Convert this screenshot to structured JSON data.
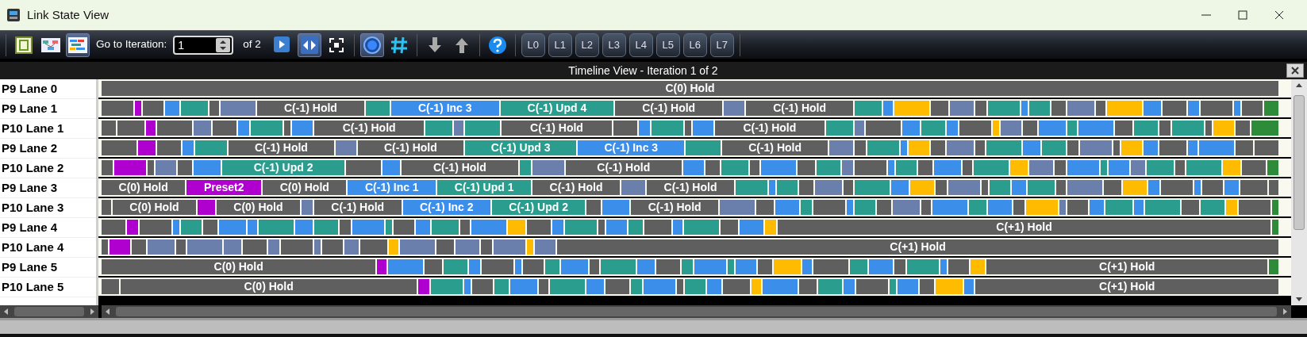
{
  "window": {
    "title": "Link State View"
  },
  "toolbar": {
    "views": [
      {
        "kind": "layout",
        "selected": false
      },
      {
        "kind": "diagram",
        "selected": false
      },
      {
        "kind": "timeline",
        "selected": true
      }
    ],
    "iteration_label": "Go to Iteration:",
    "iteration_value": "1",
    "iteration_total": "of 2",
    "tools": [
      {
        "kind": "play",
        "selected": false
      },
      {
        "kind": "sync",
        "selected": true
      },
      {
        "kind": "fit",
        "selected": false
      },
      {
        "kind": "circle",
        "selected": true
      },
      {
        "kind": "hash",
        "selected": false
      },
      {
        "kind": "down",
        "selected": false
      },
      {
        "kind": "up",
        "selected": false
      },
      {
        "kind": "help",
        "selected": false
      }
    ],
    "lane_buttons": [
      "L0",
      "L1",
      "L2",
      "L3",
      "L4",
      "L5",
      "L6",
      "L7"
    ]
  },
  "panel": {
    "title": "Timeline View - Iteration 1 of 2"
  },
  "lanes": [
    {
      "name": "P9 Lane 0",
      "segments": [
        {
          "color": "#5f5f5f",
          "label": "C(0) Hold"
        }
      ]
    },
    {
      "name": "P9 Lane 1",
      "segments": [
        {
          "color": "#5f5f5f"
        },
        {
          "color": "#b000d0"
        },
        {
          "color": "#5f5f5f"
        },
        {
          "color": "#3b8eea"
        },
        {
          "color": "#2a9d8f"
        },
        {
          "color": "#5f5f5f"
        },
        {
          "color": "#6b7fad"
        },
        {
          "color": "#5f5f5f",
          "label": "C(-1) Hold"
        },
        {
          "color": "#2a9d8f"
        },
        {
          "color": "#3b8eea",
          "label": "C(-1) Inc 3"
        },
        {
          "color": "#2a9d8f",
          "label": "C(-1) Upd 4"
        },
        {
          "color": "#5f5f5f",
          "label": "C(-1) Hold"
        },
        {
          "color": "#6b7fad"
        },
        {
          "color": "#5f5f5f",
          "label": "C(-1) Hold"
        },
        {
          "color": "#2a9d8f"
        },
        {
          "color": "#3b8eea"
        },
        {
          "color": "#ffbb00"
        },
        {
          "color": "#5f5f5f"
        },
        {
          "color": "#6b7fad"
        },
        {
          "color": "#5f5f5f"
        },
        {
          "color": "#2a9d8f"
        },
        {
          "color": "#3b8eea"
        },
        {
          "color": "#2a9d8f"
        },
        {
          "color": "#5f5f5f"
        },
        {
          "color": "#6b7fad"
        },
        {
          "color": "#5f5f5f"
        },
        {
          "color": "#ffbb00"
        },
        {
          "color": "#3b8eea"
        },
        {
          "color": "#5f5f5f"
        },
        {
          "color": "#3b8eea"
        },
        {
          "color": "#5f5f5f"
        },
        {
          "color": "#3b8eea"
        },
        {
          "color": "#5f5f5f"
        },
        {
          "color": "#2e8b3a"
        }
      ]
    },
    {
      "name": "P10 Lane 1",
      "segments": [
        {
          "color": "#5f5f5f"
        },
        {
          "color": "#5f5f5f"
        },
        {
          "color": "#b000d0"
        },
        {
          "color": "#5f5f5f"
        },
        {
          "color": "#6b7fad"
        },
        {
          "color": "#5f5f5f"
        },
        {
          "color": "#3b8eea"
        },
        {
          "color": "#2a9d8f"
        },
        {
          "color": "#5f5f5f"
        },
        {
          "color": "#3b8eea"
        },
        {
          "color": "#5f5f5f",
          "label": "C(-1) Hold"
        },
        {
          "color": "#2a9d8f"
        },
        {
          "color": "#6b7fad"
        },
        {
          "color": "#2a9d8f"
        },
        {
          "color": "#5f5f5f",
          "label": "C(-1) Hold"
        },
        {
          "color": "#5f5f5f"
        },
        {
          "color": "#3b8eea"
        },
        {
          "color": "#2a9d8f"
        },
        {
          "color": "#5f5f5f"
        },
        {
          "color": "#3b8eea"
        },
        {
          "color": "#5f5f5f",
          "label": "C(-1) Hold"
        },
        {
          "color": "#2a9d8f"
        },
        {
          "color": "#6b7fad"
        },
        {
          "color": "#5f5f5f"
        },
        {
          "color": "#3b8eea"
        },
        {
          "color": "#2a9d8f"
        },
        {
          "color": "#3b8eea"
        },
        {
          "color": "#5f5f5f"
        },
        {
          "color": "#ffbb00"
        },
        {
          "color": "#6b7fad"
        },
        {
          "color": "#5f5f5f"
        },
        {
          "color": "#3b8eea"
        },
        {
          "color": "#2a9d8f"
        },
        {
          "color": "#3b8eea"
        },
        {
          "color": "#5f5f5f"
        },
        {
          "color": "#2a9d8f"
        },
        {
          "color": "#5f5f5f"
        },
        {
          "color": "#2a9d8f"
        },
        {
          "color": "#5f5f5f"
        },
        {
          "color": "#ffbb00"
        },
        {
          "color": "#5f5f5f"
        },
        {
          "color": "#2e8b3a"
        }
      ]
    },
    {
      "name": "P9 Lane 2",
      "segments": [
        {
          "color": "#5f5f5f"
        },
        {
          "color": "#b000d0"
        },
        {
          "color": "#5f5f5f"
        },
        {
          "color": "#3b8eea"
        },
        {
          "color": "#2a9d8f"
        },
        {
          "color": "#5f5f5f",
          "label": "C(-1) Hold"
        },
        {
          "color": "#6b7fad"
        },
        {
          "color": "#5f5f5f",
          "label": "C(-1) Hold"
        },
        {
          "color": "#2a9d8f",
          "label": "C(-1) Upd 3"
        },
        {
          "color": "#3b8eea",
          "label": "C(-1) Inc 3"
        },
        {
          "color": "#2a9d8f"
        },
        {
          "color": "#5f5f5f",
          "label": "C(-1) Hold"
        },
        {
          "color": "#6b7fad"
        },
        {
          "color": "#5f5f5f"
        },
        {
          "color": "#2a9d8f"
        },
        {
          "color": "#3b8eea"
        },
        {
          "color": "#ffbb00"
        },
        {
          "color": "#5f5f5f"
        },
        {
          "color": "#6b7fad"
        },
        {
          "color": "#5f5f5f"
        },
        {
          "color": "#2a9d8f"
        },
        {
          "color": "#3b8eea"
        },
        {
          "color": "#2a9d8f"
        },
        {
          "color": "#5f5f5f"
        },
        {
          "color": "#6b7fad"
        },
        {
          "color": "#5f5f5f"
        },
        {
          "color": "#ffbb00"
        },
        {
          "color": "#3b8eea"
        },
        {
          "color": "#5f5f5f"
        },
        {
          "color": "#3b8eea"
        },
        {
          "color": "#3b8eea"
        },
        {
          "color": "#5f5f5f"
        },
        {
          "color": "#5f5f5f"
        }
      ]
    },
    {
      "name": "P10 Lane 2",
      "segments": [
        {
          "color": "#5f5f5f"
        },
        {
          "color": "#b000d0"
        },
        {
          "color": "#5f5f5f"
        },
        {
          "color": "#6b7fad"
        },
        {
          "color": "#5f5f5f"
        },
        {
          "color": "#3b8eea"
        },
        {
          "color": "#2a9d8f",
          "label": "C(-1) Upd 2"
        },
        {
          "color": "#5f5f5f"
        },
        {
          "color": "#3b8eea"
        },
        {
          "color": "#5f5f5f",
          "label": "C(-1) Hold"
        },
        {
          "color": "#2a9d8f"
        },
        {
          "color": "#6b7fad"
        },
        {
          "color": "#5f5f5f",
          "label": "C(-1) Hold"
        },
        {
          "color": "#3b8eea"
        },
        {
          "color": "#5f5f5f"
        },
        {
          "color": "#2a9d8f"
        },
        {
          "color": "#5f5f5f"
        },
        {
          "color": "#3b8eea"
        },
        {
          "color": "#5f5f5f"
        },
        {
          "color": "#2a9d8f"
        },
        {
          "color": "#6b7fad"
        },
        {
          "color": "#5f5f5f"
        },
        {
          "color": "#3b8eea"
        },
        {
          "color": "#2a9d8f"
        },
        {
          "color": "#5f5f5f"
        },
        {
          "color": "#3b8eea"
        },
        {
          "color": "#5f5f5f"
        },
        {
          "color": "#2a9d8f"
        },
        {
          "color": "#ffbb00"
        },
        {
          "color": "#6b7fad"
        },
        {
          "color": "#5f5f5f"
        },
        {
          "color": "#3b8eea"
        },
        {
          "color": "#2a9d8f"
        },
        {
          "color": "#3b8eea"
        },
        {
          "color": "#6b7fad"
        },
        {
          "color": "#2a9d8f"
        },
        {
          "color": "#5f5f5f"
        },
        {
          "color": "#2a9d8f"
        },
        {
          "color": "#ffbb00"
        },
        {
          "color": "#5f5f5f"
        },
        {
          "color": "#2e8b3a"
        }
      ]
    },
    {
      "name": "P9 Lane 3",
      "segments": [
        {
          "color": "#5f5f5f",
          "label": "C(0) Hold"
        },
        {
          "color": "#b000d0",
          "label": "Preset2"
        },
        {
          "color": "#5f5f5f",
          "label": "C(0) Hold"
        },
        {
          "color": "#3b8eea",
          "label": "C(-1) Inc 1"
        },
        {
          "color": "#2a9d8f",
          "label": "C(-1) Upd 1"
        },
        {
          "color": "#5f5f5f",
          "label": "C(-1) Hold"
        },
        {
          "color": "#6b7fad"
        },
        {
          "color": "#5f5f5f",
          "label": "C(-1) Hold"
        },
        {
          "color": "#2a9d8f"
        },
        {
          "color": "#3b8eea"
        },
        {
          "color": "#2a9d8f"
        },
        {
          "color": "#5f5f5f"
        },
        {
          "color": "#6b7fad"
        },
        {
          "color": "#5f5f5f"
        },
        {
          "color": "#2a9d8f"
        },
        {
          "color": "#3b8eea"
        },
        {
          "color": "#ffbb00"
        },
        {
          "color": "#5f5f5f"
        },
        {
          "color": "#6b7fad"
        },
        {
          "color": "#5f5f5f"
        },
        {
          "color": "#2a9d8f"
        },
        {
          "color": "#3b8eea"
        },
        {
          "color": "#2a9d8f"
        },
        {
          "color": "#5f5f5f"
        },
        {
          "color": "#6b7fad"
        },
        {
          "color": "#5f5f5f"
        },
        {
          "color": "#ffbb00"
        },
        {
          "color": "#3b8eea"
        },
        {
          "color": "#5f5f5f"
        },
        {
          "color": "#3b8eea"
        },
        {
          "color": "#5f5f5f"
        },
        {
          "color": "#3b8eea"
        },
        {
          "color": "#5f5f5f"
        },
        {
          "color": "#5f5f5f"
        }
      ]
    },
    {
      "name": "P10 Lane 3",
      "segments": [
        {
          "color": "#5f5f5f"
        },
        {
          "color": "#5f5f5f",
          "label": "C(0) Hold"
        },
        {
          "color": "#b000d0"
        },
        {
          "color": "#5f5f5f",
          "label": "C(0) Hold"
        },
        {
          "color": "#6b7fad"
        },
        {
          "color": "#5f5f5f",
          "label": "C(-1) Hold"
        },
        {
          "color": "#3b8eea",
          "label": "C(-1) Inc 2"
        },
        {
          "color": "#2a9d8f",
          "label": "C(-1) Upd 2"
        },
        {
          "color": "#5f5f5f"
        },
        {
          "color": "#3b8eea"
        },
        {
          "color": "#5f5f5f",
          "label": "C(-1) Hold"
        },
        {
          "color": "#6b7fad"
        },
        {
          "color": "#5f5f5f"
        },
        {
          "color": "#3b8eea"
        },
        {
          "color": "#2a9d8f"
        },
        {
          "color": "#5f5f5f"
        },
        {
          "color": "#3b8eea"
        },
        {
          "color": "#2a9d8f"
        },
        {
          "color": "#5f5f5f"
        },
        {
          "color": "#6b7fad"
        },
        {
          "color": "#5f5f5f"
        },
        {
          "color": "#3b8eea"
        },
        {
          "color": "#2a9d8f"
        },
        {
          "color": "#3b8eea"
        },
        {
          "color": "#5f5f5f"
        },
        {
          "color": "#ffbb00"
        },
        {
          "color": "#6b7fad"
        },
        {
          "color": "#5f5f5f"
        },
        {
          "color": "#3b8eea"
        },
        {
          "color": "#2a9d8f"
        },
        {
          "color": "#3b8eea"
        },
        {
          "color": "#2a9d8f"
        },
        {
          "color": "#5f5f5f"
        },
        {
          "color": "#2a9d8f"
        },
        {
          "color": "#ffbb00"
        },
        {
          "color": "#5f5f5f"
        },
        {
          "color": "#2e8b3a"
        }
      ]
    },
    {
      "name": "P9 Lane 4",
      "segments": [
        {
          "color": "#5f5f5f"
        },
        {
          "color": "#b000d0"
        },
        {
          "color": "#5f5f5f"
        },
        {
          "color": "#3b8eea"
        },
        {
          "color": "#2a9d8f"
        },
        {
          "color": "#5f5f5f"
        },
        {
          "color": "#3b8eea"
        },
        {
          "color": "#3b8eea"
        },
        {
          "color": "#2a9d8f"
        },
        {
          "color": "#3b8eea"
        },
        {
          "color": "#2a9d8f"
        },
        {
          "color": "#5f5f5f"
        },
        {
          "color": "#3b8eea"
        },
        {
          "color": "#2a9d8f"
        },
        {
          "color": "#5f5f5f"
        },
        {
          "color": "#3b8eea"
        },
        {
          "color": "#2a9d8f"
        },
        {
          "color": "#5f5f5f"
        },
        {
          "color": "#3b8eea"
        },
        {
          "color": "#ffbb00"
        },
        {
          "color": "#5f5f5f"
        },
        {
          "color": "#3b8eea"
        },
        {
          "color": "#2a9d8f"
        },
        {
          "color": "#5f5f5f"
        },
        {
          "color": "#3b8eea"
        },
        {
          "color": "#2a9d8f"
        },
        {
          "color": "#5f5f5f"
        },
        {
          "color": "#3b8eea"
        },
        {
          "color": "#2a9d8f"
        },
        {
          "color": "#5f5f5f"
        },
        {
          "color": "#3b8eea"
        },
        {
          "color": "#ffbb00"
        },
        {
          "color": "#5f5f5f",
          "label": "C(+1) Hold"
        },
        {
          "color": "#2e8b3a"
        }
      ]
    },
    {
      "name": "P10 Lane 4",
      "segments": [
        {
          "color": "#5f5f5f"
        },
        {
          "color": "#b000d0"
        },
        {
          "color": "#5f5f5f"
        },
        {
          "color": "#6b7fad"
        },
        {
          "color": "#5f5f5f"
        },
        {
          "color": "#6b7fad"
        },
        {
          "color": "#6b7fad"
        },
        {
          "color": "#5f5f5f"
        },
        {
          "color": "#6b7fad"
        },
        {
          "color": "#5f5f5f"
        },
        {
          "color": "#6b7fad"
        },
        {
          "color": "#5f5f5f"
        },
        {
          "color": "#6b7fad"
        },
        {
          "color": "#5f5f5f"
        },
        {
          "color": "#ffbb00"
        },
        {
          "color": "#6b7fad"
        },
        {
          "color": "#5f5f5f"
        },
        {
          "color": "#6b7fad"
        },
        {
          "color": "#5f5f5f"
        },
        {
          "color": "#6b7fad"
        },
        {
          "color": "#ffbb00"
        },
        {
          "color": "#6b7fad"
        },
        {
          "color": "#5f5f5f",
          "label": "C(+1) Hold"
        }
      ]
    },
    {
      "name": "P9 Lane 5",
      "segments": [
        {
          "color": "#5f5f5f",
          "label": "C(0) Hold"
        },
        {
          "color": "#b000d0"
        },
        {
          "color": "#3b8eea"
        },
        {
          "color": "#5f5f5f"
        },
        {
          "color": "#2a9d8f"
        },
        {
          "color": "#3b8eea"
        },
        {
          "color": "#5f5f5f"
        },
        {
          "color": "#3b8eea"
        },
        {
          "color": "#5f5f5f"
        },
        {
          "color": "#2a9d8f"
        },
        {
          "color": "#3b8eea"
        },
        {
          "color": "#5f5f5f"
        },
        {
          "color": "#2a9d8f"
        },
        {
          "color": "#3b8eea"
        },
        {
          "color": "#5f5f5f"
        },
        {
          "color": "#2a9d8f"
        },
        {
          "color": "#3b8eea"
        },
        {
          "color": "#2a9d8f"
        },
        {
          "color": "#3b8eea"
        },
        {
          "color": "#5f5f5f"
        },
        {
          "color": "#ffbb00"
        },
        {
          "color": "#3b8eea"
        },
        {
          "color": "#5f5f5f"
        },
        {
          "color": "#2a9d8f"
        },
        {
          "color": "#3b8eea"
        },
        {
          "color": "#5f5f5f"
        },
        {
          "color": "#2a9d8f"
        },
        {
          "color": "#3b8eea"
        },
        {
          "color": "#5f5f5f"
        },
        {
          "color": "#ffbb00"
        },
        {
          "color": "#5f5f5f",
          "label": "C(+1) Hold"
        },
        {
          "color": "#2e8b3a"
        }
      ]
    },
    {
      "name": "P10 Lane 5",
      "segments": [
        {
          "color": "#5f5f5f"
        },
        {
          "color": "#5f5f5f",
          "label": "C(0) Hold"
        },
        {
          "color": "#b000d0"
        },
        {
          "color": "#2a9d8f"
        },
        {
          "color": "#3b8eea"
        },
        {
          "color": "#5f5f5f"
        },
        {
          "color": "#2a9d8f"
        },
        {
          "color": "#3b8eea"
        },
        {
          "color": "#5f5f5f"
        },
        {
          "color": "#2a9d8f"
        },
        {
          "color": "#3b8eea"
        },
        {
          "color": "#5f5f5f"
        },
        {
          "color": "#2a9d8f"
        },
        {
          "color": "#3b8eea"
        },
        {
          "color": "#5f5f5f"
        },
        {
          "color": "#2a9d8f"
        },
        {
          "color": "#3b8eea"
        },
        {
          "color": "#5f5f5f"
        },
        {
          "color": "#ffbb00"
        },
        {
          "color": "#3b8eea"
        },
        {
          "color": "#5f5f5f"
        },
        {
          "color": "#2a9d8f"
        },
        {
          "color": "#3b8eea"
        },
        {
          "color": "#5f5f5f"
        },
        {
          "color": "#2a9d8f"
        },
        {
          "color": "#3b8eea"
        },
        {
          "color": "#5f5f5f"
        },
        {
          "color": "#ffbb00"
        },
        {
          "color": "#3b8eea"
        },
        {
          "color": "#5f5f5f",
          "label": "C(+1) Hold"
        }
      ]
    }
  ]
}
